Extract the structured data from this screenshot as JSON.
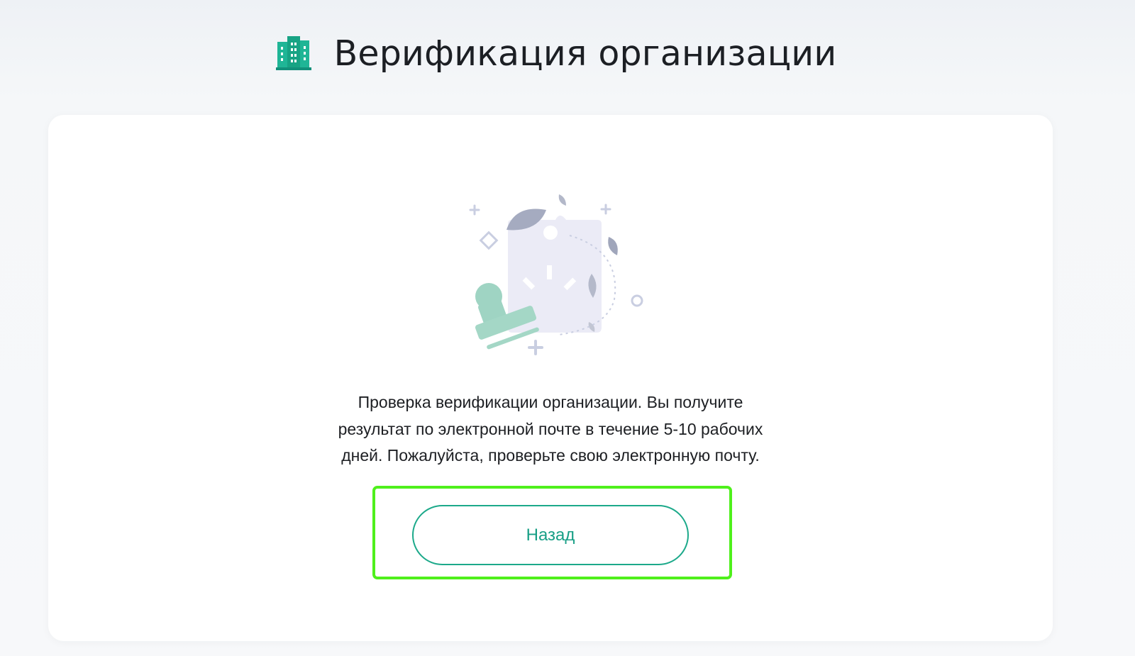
{
  "header": {
    "title": "Верификация организации",
    "icon": "building-icon"
  },
  "illustration": {
    "icon": "document-stamp-illustration"
  },
  "message": {
    "line1": "Проверка верификации организации. Вы получите",
    "line2": "результат по электронной почте в течение 5-10 рабочих",
    "line3": "дней. Пожалуйста, проверьте свою электронную почту."
  },
  "actions": {
    "back_label": "Назад"
  },
  "colors": {
    "accent": "#1ca98a",
    "highlight": "#4ff01c",
    "title": "#1c1f24"
  }
}
